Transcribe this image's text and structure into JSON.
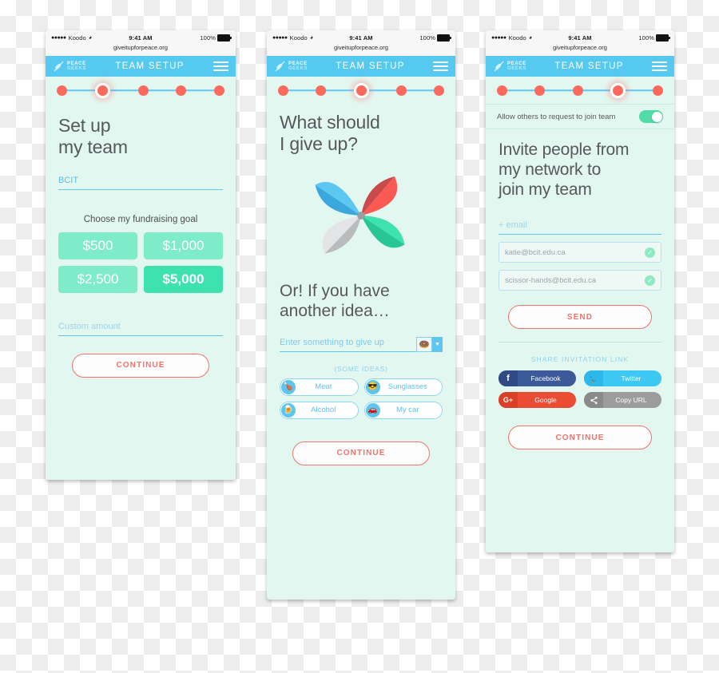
{
  "status_bar": {
    "carrier_dots": "●●●●●",
    "carrier": "Koodo",
    "wifi_icon": "wifi-icon",
    "time": "9:41 AM",
    "battery_percent": "100%",
    "url": "giveitupforpeace.org"
  },
  "app_bar": {
    "logo_line1": "PEACE",
    "logo_line2": "GEEKS",
    "title": "TEAM SETUP",
    "menu_icon": "hamburger-menu-icon"
  },
  "colors": {
    "accent_blue": "#55c9ef",
    "accent_red": "#fc6a5d",
    "accent_green": "#3ee2ae",
    "screen_bg": "#e3f7f1"
  },
  "screen1": {
    "progress": {
      "total": 5,
      "active_index": 1
    },
    "heading": "Set up\nmy team",
    "team_name_value": "BCIT",
    "fundraising_label": "Choose my fundraising goal",
    "goals": [
      {
        "label": "$500",
        "selected": false
      },
      {
        "label": "$1,000",
        "selected": false
      },
      {
        "label": "$2,500",
        "selected": false
      },
      {
        "label": "$5,000",
        "selected": true
      }
    ],
    "custom_amount_placeholder": "Custom amount",
    "continue_label": "CONTINUE"
  },
  "screen2": {
    "progress": {
      "total": 5,
      "active_index": 2
    },
    "heading": "What should\nI give up?",
    "pinwheel_icon": "pinwheel-logo-icon",
    "subheading": "Or! If you have\nanother idea…",
    "idea_input_placeholder": "Enter something to give up",
    "emoji_selected": "🍩",
    "emoji_dropdown_icon": "chevron-down-icon",
    "ideas_label": "(SOME IDEAS)",
    "ideas": [
      {
        "label": "Meat",
        "emoji": "🍗"
      },
      {
        "label": "Sunglasses",
        "emoji": "😎"
      },
      {
        "label": "Alcohol",
        "emoji": "🍺"
      },
      {
        "label": "My car",
        "emoji": "🚗"
      }
    ],
    "continue_label": "CONTINUE"
  },
  "screen3": {
    "progress": {
      "total": 5,
      "active_index": 3
    },
    "allow_requests_label": "Allow others to request to join team",
    "allow_requests_on": true,
    "heading": "Invite people from\nmy network to\njoin my team",
    "email_input_placeholder": "+ email",
    "invited_emails": [
      {
        "email": "katie@bcit.edu.ca",
        "verified": true
      },
      {
        "email": "scissor-hands@bcit.edu.ca",
        "verified": true
      }
    ],
    "send_label": "SEND",
    "share_label": "SHARE INVITATION LINK",
    "share_buttons": [
      {
        "label": "Facebook",
        "icon": "facebook-icon",
        "glyph": "f",
        "bg": "#3c5a9a",
        "icon_bg": "#2f4a87"
      },
      {
        "label": "Twitter",
        "icon": "twitter-icon",
        "glyph": "🐦",
        "bg": "#3cc8f2",
        "icon_bg": "#2ab9e8"
      },
      {
        "label": "Google",
        "icon": "google-plus-icon",
        "glyph": "G+",
        "bg": "#ea4c34",
        "icon_bg": "#da3f28"
      },
      {
        "label": "Copy URL",
        "icon": "share-link-icon",
        "glyph": "⚭",
        "bg": "#9c9c9c",
        "icon_bg": "#8a8a8a"
      }
    ],
    "continue_label": "CONTINUE"
  }
}
